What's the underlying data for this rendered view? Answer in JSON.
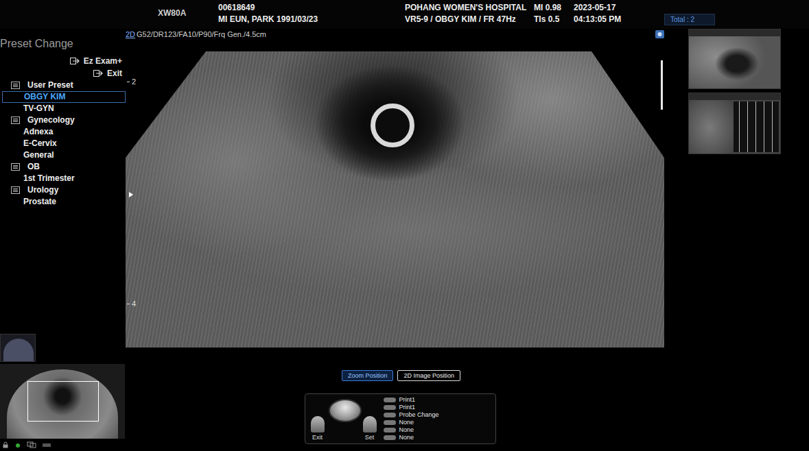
{
  "header": {
    "model": "XW80A",
    "patient_id": "00618649",
    "patient": "MI EUN, PARK 1991/03/23",
    "hospital": "POHANG WOMEN'S HOSPITAL",
    "probe_info": "VR5-9 / OBGY KIM / FR 47Hz",
    "mi": "MI 0.98",
    "tis": "TIs 0.5",
    "date": "2023-05-17",
    "time": "04:13:05 PM",
    "total": "Total : 2"
  },
  "imaging": {
    "mode": "2D",
    "params": "G52/DR123/FA10/P90/Frq Gen./4.5cm",
    "depth_marks": [
      "2",
      "4"
    ]
  },
  "sidebar": {
    "title": "Preset Change",
    "actions": [
      "Ez Exam+",
      "Exit"
    ],
    "items": [
      {
        "label": "User Preset",
        "kind": "group",
        "selected": false
      },
      {
        "label": "OBGY KIM",
        "kind": "item",
        "selected": true
      },
      {
        "label": "TV-GYN",
        "kind": "item",
        "selected": false
      },
      {
        "label": "Gynecology",
        "kind": "group",
        "selected": false
      },
      {
        "label": "Adnexa",
        "kind": "item",
        "selected": false
      },
      {
        "label": "E-Cervix",
        "kind": "item",
        "selected": false
      },
      {
        "label": "General",
        "kind": "item",
        "selected": false
      },
      {
        "label": "OB",
        "kind": "group",
        "selected": false
      },
      {
        "label": "1st Trimester",
        "kind": "item",
        "selected": false
      },
      {
        "label": "Urology",
        "kind": "group",
        "selected": false
      },
      {
        "label": "Prostate",
        "kind": "item",
        "selected": false
      }
    ]
  },
  "view_buttons": [
    {
      "label": "Zoom Position",
      "selected": true
    },
    {
      "label": "2D Image Position",
      "selected": false
    }
  ],
  "control_panel": {
    "trackball_buttons": [
      "Exit",
      "Set"
    ],
    "keys": [
      "Print1",
      "Print1",
      "Probe Change",
      "None",
      "None",
      "None"
    ]
  }
}
